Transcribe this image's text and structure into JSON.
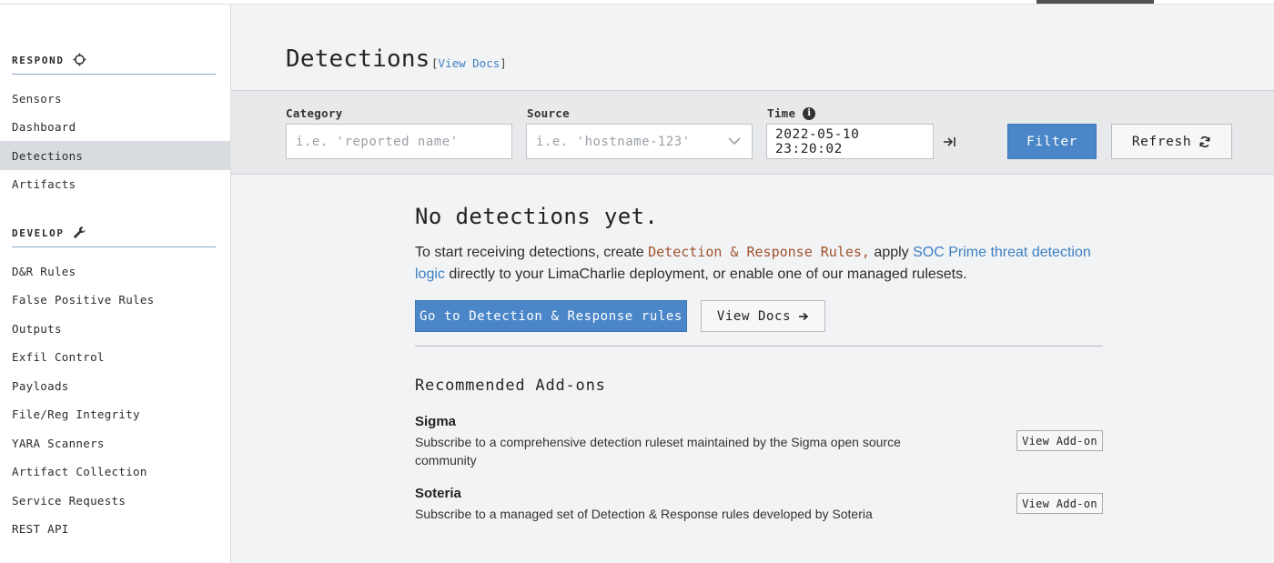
{
  "sidebar": {
    "respond_title": "RESPOND",
    "respond_items": [
      {
        "label": "Sensors"
      },
      {
        "label": "Dashboard"
      },
      {
        "label": "Detections",
        "active": true
      },
      {
        "label": "Artifacts"
      }
    ],
    "develop_title": "DEVELOP",
    "develop_items": [
      {
        "label": "D&R Rules"
      },
      {
        "label": "False Positive Rules"
      },
      {
        "label": "Outputs"
      },
      {
        "label": "Exfil Control"
      },
      {
        "label": "Payloads"
      },
      {
        "label": "File/Reg Integrity"
      },
      {
        "label": "YARA Scanners"
      },
      {
        "label": "Artifact Collection"
      },
      {
        "label": "Service Requests"
      },
      {
        "label": "REST API"
      }
    ]
  },
  "header": {
    "title": "Detections",
    "docs_open": "[",
    "docs_link": "View Docs",
    "docs_close": "]"
  },
  "filters": {
    "category_label": "Category",
    "category_placeholder": "i.e. 'reported name'",
    "source_label": "Source",
    "source_placeholder": "i.e. 'hostname-123'",
    "time_label": "Time",
    "time_value": "2022-05-10 23:20:02",
    "filter_button": "Filter",
    "refresh_button": "Refresh"
  },
  "empty_state": {
    "title": "No detections yet.",
    "desc_part1": "To start receiving detections, create ",
    "desc_code": "Detection & Response Rules,",
    "desc_part2": " apply ",
    "desc_link": "SOC Prime threat detection logic",
    "desc_part3": " directly to your LimaCharlie deployment, or enable one of our managed rulesets.",
    "primary_button": "Go to Detection & Response rules",
    "docs_button": "View Docs"
  },
  "addons": {
    "title": "Recommended Add-ons",
    "items": [
      {
        "name": "Sigma",
        "description": "Subscribe to a comprehensive detection ruleset maintained by the Sigma open source community",
        "button": "View Add-on"
      },
      {
        "name": "Soteria",
        "description": "Subscribe to a managed set of Detection & Response rules developed by Soteria",
        "button": "View Add-on"
      }
    ]
  },
  "colors": {
    "accent": "#4a86c8",
    "link": "#3d7fc2",
    "code": "#a0522d",
    "active_nav": "#d8dce1"
  }
}
